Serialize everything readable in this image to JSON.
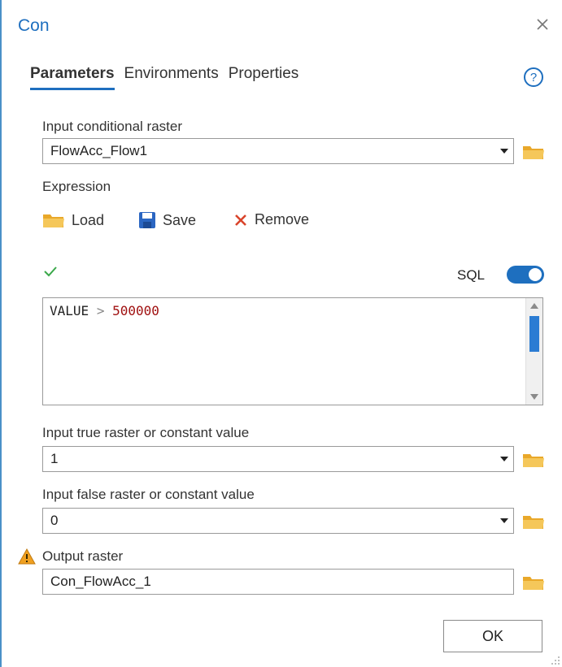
{
  "pane": {
    "title": "Con"
  },
  "tabs": [
    {
      "label": "Parameters",
      "active": true
    },
    {
      "label": "Environments",
      "active": false
    },
    {
      "label": "Properties",
      "active": false
    }
  ],
  "params": {
    "input_conditional_raster": {
      "label": "Input conditional raster",
      "value": "FlowAcc_Flow1"
    },
    "expression": {
      "label": "Expression",
      "load_label": "Load",
      "save_label": "Save",
      "remove_label": "Remove",
      "sql_label": "SQL",
      "sql_enabled": true,
      "field": "VALUE",
      "operator": ">",
      "value": "500000"
    },
    "input_true": {
      "label": "Input true raster or constant value",
      "value": "1"
    },
    "input_false": {
      "label": "Input false raster or constant value",
      "value": "0"
    },
    "output_raster": {
      "label": "Output raster",
      "value": "Con_FlowAcc_1",
      "warning": true
    }
  },
  "ok_label": "OK",
  "colors": {
    "accent": "#1e6fbf",
    "folder": "#f2c14e",
    "remove": "#d9442b",
    "check": "#3aa84a",
    "warning": "#f0a020"
  }
}
